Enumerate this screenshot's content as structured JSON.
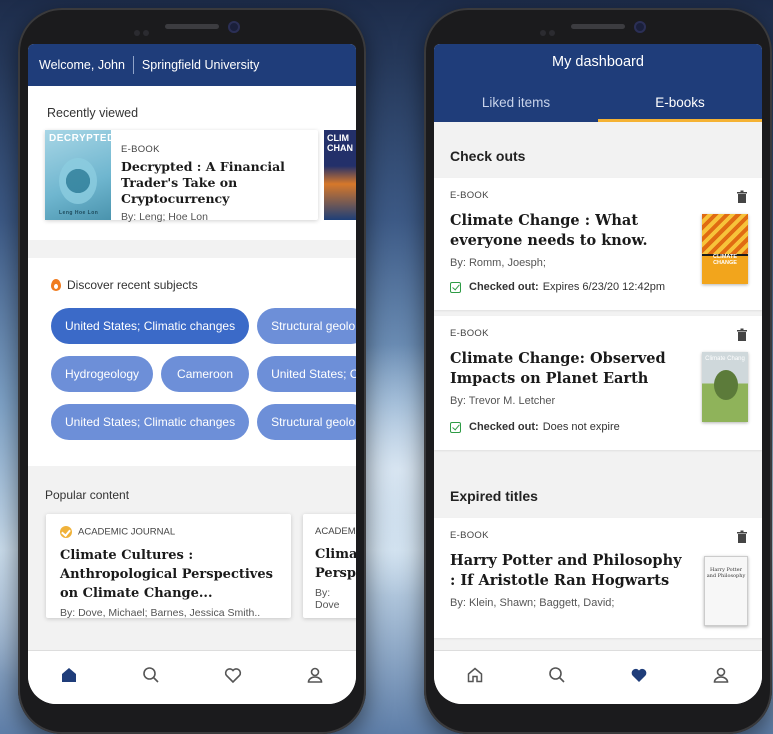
{
  "left_screen": {
    "header": {
      "welcome": "Welcome, John",
      "institution": "Springfield University"
    },
    "recently_viewed": {
      "title": "Recently viewed",
      "items": [
        {
          "cover_text": "DECRYPTED",
          "kind": "E-BOOK",
          "title": "Decrypted : A Financial Trader's Take on Cryptocurrency",
          "by": "By: Leng; Hoe Lon",
          "cover_author": "Leng Hoe Lon"
        },
        {
          "cover_text": "CLIM CHAN"
        }
      ]
    },
    "subjects": {
      "title": "Discover recent subjects",
      "rows": [
        [
          "United States; Climatic changes",
          "Structural geolo"
        ],
        [
          "Hydrogeology",
          "Cameroon",
          "United States; C"
        ],
        [
          "United States; Climatic changes",
          "Structural geolo"
        ]
      ]
    },
    "popular": {
      "title": "Popular content",
      "items": [
        {
          "kind": "ACADEMIC JOURNAL",
          "title": "Climate Cultures : Anthropological Perspectives on Climate Change...",
          "by": "By: Dove, Michael; Barnes, Jessica Smith.."
        },
        {
          "kind": "ACADEM",
          "title": "Climat Perspe",
          "by": "By: Dove"
        }
      ]
    },
    "nav": [
      "home-icon",
      "search-icon",
      "heart-icon",
      "profile-icon"
    ]
  },
  "right_screen": {
    "header": {
      "title": "My dashboard",
      "tabs": [
        "Liked items",
        "E-books"
      ],
      "active_tab": "E-books"
    },
    "checkouts": {
      "title": "Check outs",
      "items": [
        {
          "kind": "E-BOOK",
          "title": "Climate Change : What everyone needs to know.",
          "by": "By: Romm, Joesph;",
          "status_label": "Checked out:",
          "status_value": "Expires 6/23/20 12:42pm",
          "cover_text": "CLIMATE CHANGE"
        },
        {
          "kind": "E-BOOK",
          "title": "Climate Change: Observed Impacts on Planet Earth",
          "by": "By: Trevor M. Letcher",
          "status_label": "Checked out:",
          "status_value": "Does not expire",
          "cover_text": "Climate Chang"
        }
      ]
    },
    "expired": {
      "title": "Expired titles",
      "items": [
        {
          "kind": "E-BOOK",
          "title": "Harry Potter and Philosophy : If Aristotle Ran Hogwarts",
          "by": "By: Klein, Shawn; Baggett, David;",
          "cover_text": "Harry Potter and Philosophy"
        }
      ]
    },
    "nav": [
      "home-icon",
      "search-icon",
      "heart-icon",
      "profile-icon"
    ]
  },
  "colors": {
    "brand_blue": "#1f3d7a",
    "chip_blue": "#6d8fd8",
    "accent_orange": "#f5b233",
    "check_green": "#2e9b45"
  }
}
